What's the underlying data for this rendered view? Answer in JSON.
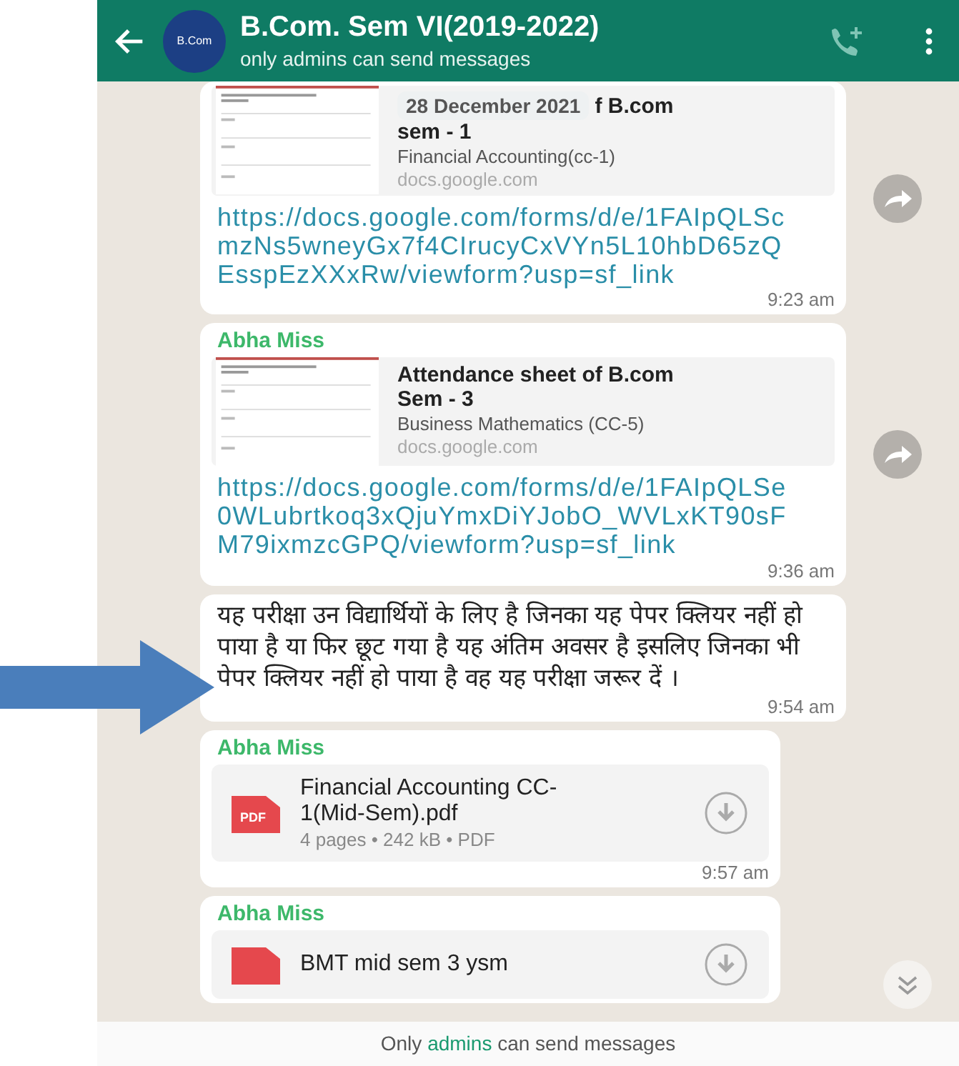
{
  "header": {
    "title": "B.Com. Sem VI(2019-2022)",
    "subtitle": "only admins can send messages",
    "avatar_text": "B.Com"
  },
  "messages": [
    {
      "kind": "link",
      "date_pill": "28 December 2021",
      "preview_title_lines": [
        "f B.com",
        "sem - 1"
      ],
      "preview_desc": "Financial Accounting(cc-1)",
      "preview_domain": "docs.google.com",
      "url": "https://docs.google.com/forms/d/e/1FAIpQLScmzNs5wneyGx7f4CIrucyCxVYn5L10hbD65zQEsspEzXXxRw/viewform?usp=sf_link",
      "time": "9:23 am",
      "forward": true
    },
    {
      "kind": "link",
      "sender": "Abha Miss",
      "preview_title_lines": [
        "Attendance sheet of B.com",
        "Sem - 3"
      ],
      "preview_desc": "Business Mathematics (CC-5)",
      "preview_domain": "docs.google.com",
      "url": "https://docs.google.com/forms/d/e/1FAIpQLSe0WLubrtkoq3xQjuYmxDiYJobO_WVLxKT90sFM79ixmzcGPQ/viewform?usp=sf_link",
      "time": "9:36 am",
      "forward": true
    },
    {
      "kind": "text",
      "text": "यह परीक्षा उन विद्यार्थियों के लिए है जिनका यह पेपर क्लियर नहीं हो पाया है या फिर छूट गया है यह अंतिम अवसर है इसलिए जिनका भी पेपर क्लियर नहीं हो पाया है वह यह परीक्षा जरूर दें ।",
      "time": "9:54 am",
      "forward": false
    },
    {
      "kind": "file",
      "sender": "Abha Miss",
      "file_badge": "PDF",
      "file_name": "Financial Accounting CC-1(Mid-Sem).pdf",
      "file_meta": "4 pages • 242 kB • PDF",
      "time": "9:57 am",
      "forward": false
    },
    {
      "kind": "file",
      "sender": "Abha Miss",
      "file_name": "BMT mid sem 3 ysm",
      "forward": false
    }
  ],
  "footer": {
    "before": "Only",
    "highlight": "admins",
    "after": "can send messages"
  }
}
